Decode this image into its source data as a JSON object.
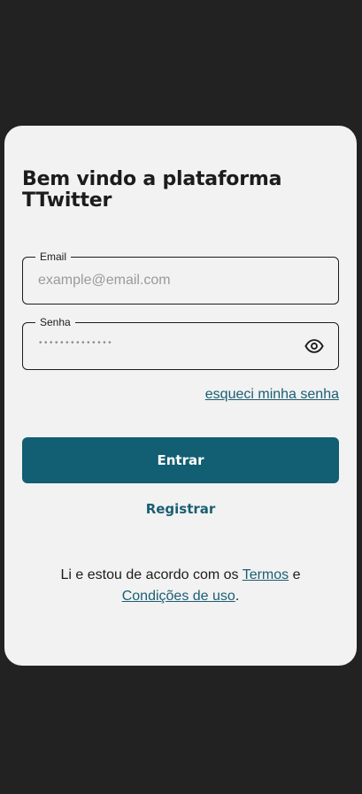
{
  "login": {
    "title": "Bem vindo a plataforma TTwitter",
    "email": {
      "label": "Email",
      "value": "",
      "placeholder": "example@email.com"
    },
    "password": {
      "label": "Senha",
      "masked_value": "••••••••••••••",
      "icon": "eye-icon"
    },
    "forgot_password_label": "esqueci minha senha",
    "login_button_label": "Entrar",
    "register_label": "Registrar"
  },
  "terms": {
    "text_before": "Li e estou de acordo com os ",
    "terms_link": "Termos",
    "connector": " e ",
    "conditions_link": "Condições de uso",
    "period": "."
  },
  "colors": {
    "background": "#222222",
    "card": "#f2f2f2",
    "accent": "#125e73",
    "link": "#1b5e73",
    "text": "#1c1c1c"
  }
}
